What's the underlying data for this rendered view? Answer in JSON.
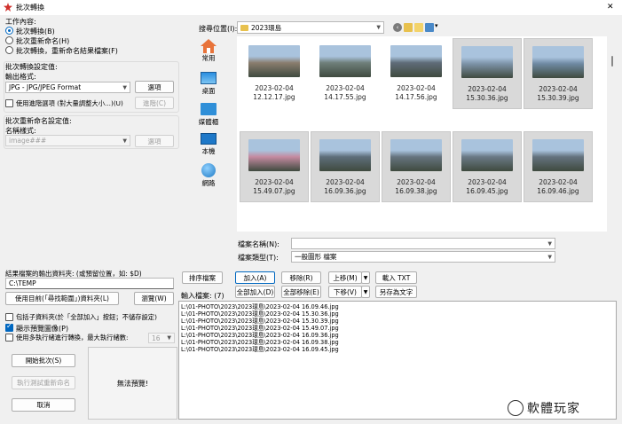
{
  "window": {
    "title": "批次轉換",
    "close_glyph": "✕"
  },
  "work": {
    "group_label": "工作內容:",
    "options": [
      "批次轉換(B)",
      "批次重新命名(H)",
      "批次轉換，重新命名結果檔案(F)"
    ],
    "selected_index": 0
  },
  "convert": {
    "group_label": "批次轉換設定值:",
    "format_label": "輸出格式:",
    "format_value": "JPG - JPG/JPEG Format",
    "options_button": "選項",
    "advanced_label": "使用進階選項 (對大量調整大小...)(U)",
    "advanced_checked": false,
    "advanced_button": "進階(C)"
  },
  "rename": {
    "group_label": "批次重新命名設定值:",
    "name_pattern_label": "名稱樣式:",
    "name_pattern_value": "image###",
    "options_button": "選項"
  },
  "output": {
    "folder_label": "結果檔案的輸出資料夾: (或預留位置，如: $D)",
    "folder_value": "C:\\TEMP",
    "use_current_button": "使用目前(「尋找範圍」)資料夾(L)",
    "browse_button": "瀏覽(W)"
  },
  "checks": {
    "subfolders_label": "包括子資料夾(於「全部加入」按鈕；不儲存設定)",
    "subfolders_checked": false,
    "preview_label": "顯示預覽圖像(P)",
    "preview_checked": true,
    "multithread_label": "使用多執行緒進行轉換，最大執行緒數:",
    "multithread_checked": false,
    "multithread_value": "16"
  },
  "actions": {
    "start_button": "開始批次(S)",
    "test_rename_button": "執行測試重新命名",
    "cancel_button": "取消"
  },
  "preview": {
    "no_preview_text": "無法預覽!"
  },
  "browser": {
    "look_in_label": "搜尋位置(I):",
    "look_in_value": "2023環島",
    "view_icon_label": "▾",
    "places": [
      {
        "label": "常用",
        "icon": "home-icon"
      },
      {
        "label": "桌面",
        "icon": "desktop-icon"
      },
      {
        "label": "媒體櫃",
        "icon": "library-icon"
      },
      {
        "label": "本機",
        "icon": "computer-icon"
      },
      {
        "label": "網路",
        "icon": "network-icon"
      }
    ],
    "files": [
      {
        "date": "2023-02-04",
        "time": "12.12.17.jpg",
        "selected": false,
        "color": "#8a7d6e"
      },
      {
        "date": "2023-02-04",
        "time": "14.17.55.jpg",
        "selected": false,
        "color": "#6f7f7a"
      },
      {
        "date": "2023-02-04",
        "time": "14.17.56.jpg",
        "selected": false,
        "color": "#5f6c78"
      },
      {
        "date": "2023-02-04",
        "time": "15.30.36.jpg",
        "selected": true,
        "color": "#7d93a8"
      },
      {
        "date": "2023-02-04",
        "time": "15.30.39.jpg",
        "selected": true,
        "color": "#6f8aa3"
      },
      {
        "date": "2023-02-04",
        "time": "15.49.07.jpg",
        "selected": true,
        "color": "#c48aa0"
      },
      {
        "date": "2023-02-04",
        "time": "16.09.36.jpg",
        "selected": true,
        "color": "#5e6e7a"
      },
      {
        "date": "2023-02-04",
        "time": "16.09.38.jpg",
        "selected": true,
        "color": "#66747f"
      },
      {
        "date": "2023-02-04",
        "time": "16.09.45.jpg",
        "selected": true,
        "color": "#6a7985"
      },
      {
        "date": "2023-02-04",
        "time": "16.09.46.jpg",
        "selected": true,
        "color": "#64727e"
      }
    ],
    "filename_label": "檔案名稱(N):",
    "filename_value": "",
    "filetype_label": "檔案類型(T):",
    "filetype_value": "一般圖形 檔案"
  },
  "list_controls": {
    "sort_button": "排序檔案",
    "add_button": "加入(A)",
    "remove_button": "移除(R)",
    "up_button": "上移(M)",
    "load_txt_button": "載入 TXT",
    "input_files_label": "輸入檔案: (7)",
    "add_all_button": "全部加入(D)",
    "remove_all_button": "全部移除(E)",
    "down_button": "下移(V)",
    "save_as_text_button": "另存為文字"
  },
  "input_files": [
    "L:\\01-PHOTO\\2023\\2023環島\\2023-02-04 16.09.46.jpg",
    "L:\\01-PHOTO\\2023\\2023環島\\2023-02-04 15.30.36.jpg",
    "L:\\01-PHOTO\\2023\\2023環島\\2023-02-04 15.30.39.jpg",
    "L:\\01-PHOTO\\2023\\2023環島\\2023-02-04 15.49.07.jpg",
    "L:\\01-PHOTO\\2023\\2023環島\\2023-02-04 16.09.36.jpg",
    "L:\\01-PHOTO\\2023\\2023環島\\2023-02-04 16.09.38.jpg",
    "L:\\01-PHOTO\\2023\\2023環島\\2023-02-04 16.09.45.jpg"
  ],
  "watermark": "軟體玩家"
}
